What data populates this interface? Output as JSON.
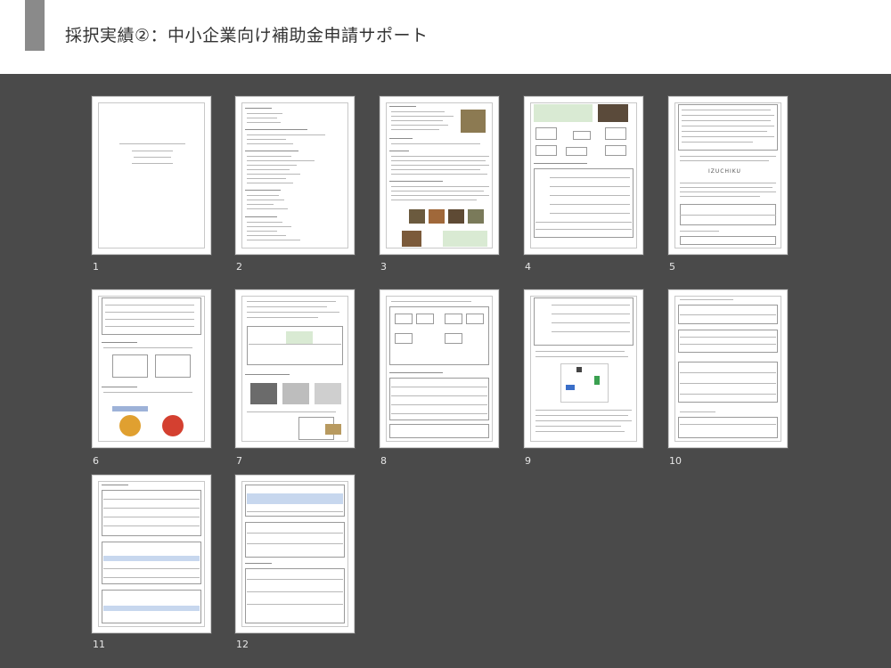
{
  "header": {
    "title": "採択実績②：中小企業向け補助金申請サポート"
  },
  "pages": [
    {
      "number": "1"
    },
    {
      "number": "2"
    },
    {
      "number": "3"
    },
    {
      "number": "4"
    },
    {
      "number": "5"
    },
    {
      "number": "6"
    },
    {
      "number": "7"
    },
    {
      "number": "8"
    },
    {
      "number": "9"
    },
    {
      "number": "10"
    },
    {
      "number": "11"
    },
    {
      "number": "12"
    }
  ],
  "page5": {
    "logo_text": "IZUCHIKU"
  },
  "colors": {
    "background": "#4a4a4a",
    "header": "#ffffff",
    "accent_bar": "#8a8a8a",
    "highlight_green": "#d9ead3",
    "table_blue": "#c7d7ee"
  }
}
